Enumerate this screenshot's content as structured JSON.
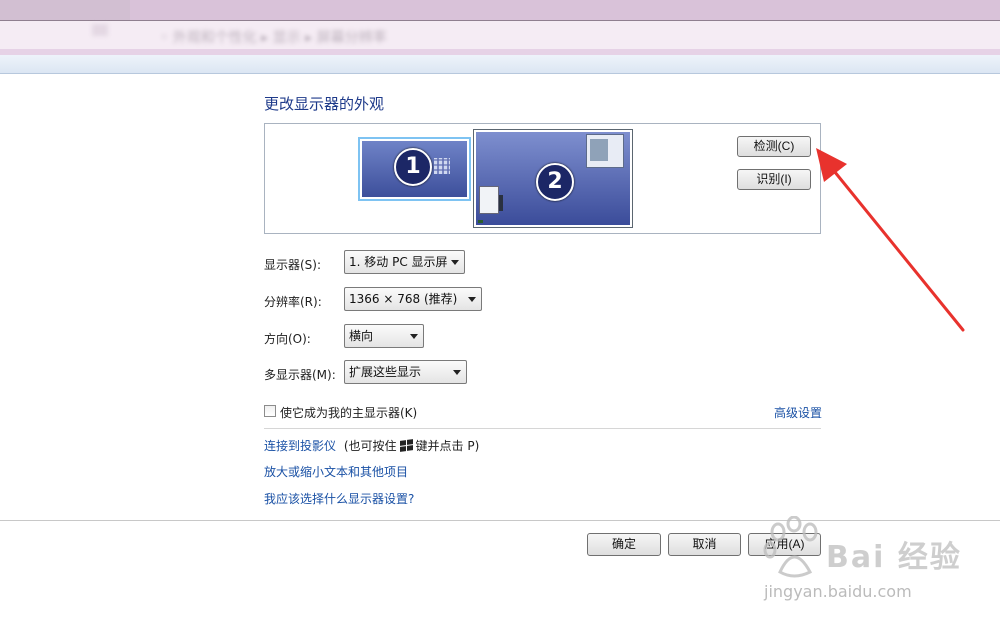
{
  "window": {
    "title_blurred": "◦  外观和个性化 ▸ 显示 ▸ 屏幕分辨率"
  },
  "heading": "更改显示器的外观",
  "preview": {
    "monitor1_number": "1",
    "monitor2_number": "2",
    "detect_label": "检测(C)",
    "identify_label": "识别(I)"
  },
  "form": {
    "display_label": "显示器(S):",
    "display_value": "1. 移动 PC 显示屏",
    "resolution_label": "分辨率(R):",
    "resolution_value": "1366 × 768 (推荐)",
    "orientation_label": "方向(O):",
    "orientation_value": "横向",
    "multi_label": "多显示器(M):",
    "multi_value": "扩展这些显示"
  },
  "options": {
    "primary_checkbox_label": "使它成为我的主显示器(K)",
    "advanced_link": "高级设置"
  },
  "links": {
    "projector_link": "连接到投影仪",
    "projector_hint_prefix": "(也可按住",
    "projector_hint_suffix": "键并点击 P)",
    "text_size_link": "放大或缩小文本和其他项目",
    "which_settings_link": "我应该选择什么显示器设置?"
  },
  "footer": {
    "ok_label": "确定",
    "cancel_label": "取消",
    "apply_label": "应用(A)"
  },
  "watermark": {
    "brand_text": "Bai 经验",
    "url": "jingyan.baidu.com"
  },
  "colors": {
    "link": "#1a51a5",
    "heading": "#1e3a8a",
    "annotation_arrow": "#e8322d",
    "selected_monitor_border": "#7ec3f2"
  }
}
